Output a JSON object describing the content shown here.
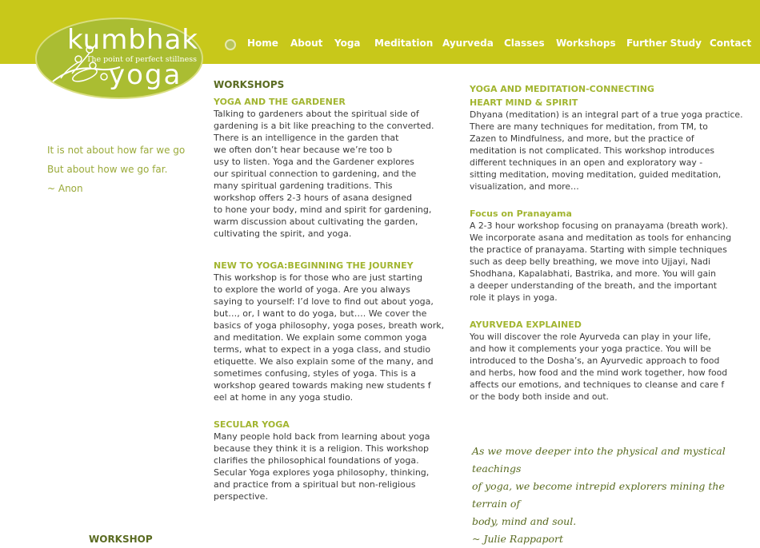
{
  "logo": {
    "top_text": "kumbhak",
    "tagline": "The point of perfect stillness",
    "bottom_text": "yoga"
  },
  "nav": {
    "items": [
      "Home",
      "About",
      "Yoga",
      "Meditation",
      "Ayurveda",
      "Classes",
      "Workshops",
      "Further Study",
      "Contact"
    ]
  },
  "quote_left": {
    "line1": "It is not about how far we go",
    "line2": "But about how we go far.",
    "author": "~ Anon"
  },
  "main": {
    "heading": "WORKSHOPS",
    "sections": [
      {
        "title": "YOGA AND THE GARDENER",
        "lines": [
          "Talking to gardeners about the spiritual side of",
          "gardening is a bit like preaching to the converted.",
          "There is an intelligence in the garden that",
          "we often don’t hear because we’re too b",
          "usy to listen. Yoga and the Gardener explores",
          "our spiritual connection to gardening, and the",
          "many spiritual gardening traditions. This",
          "workshop offers 2-3 hours of asana designed",
          "to hone your body, mind and spirit for gardening,",
          "warm discussion about cultivating the garden,",
          "cultivating the spirit, and yoga."
        ]
      },
      {
        "title": "NEW TO YOGA:BEGINNING THE JOURNEY",
        "lines": [
          "This workshop is for those who are just starting",
          "to explore the world of yoga. Are you always",
          "saying to yourself: I’d love to find out about yoga,",
          "but…, or, I want to do yoga, but…. We cover the",
          "basics of yoga philosophy, yoga poses, breath work,",
          "and meditation. We explain some common yoga",
          "terms, what to expect in a yoga class, and studio",
          "etiquette. We also explain some of the many, and",
          "sometimes confusing, styles of yoga. This is a",
          "workshop geared towards making new students f",
          "eel at home in any yoga studio."
        ]
      },
      {
        "title": "SECULAR YOGA",
        "lines": [
          "Many people hold back from learning about yoga",
          "because they think it is a religion. This workshop",
          "clarifies the philosophical foundations of yoga.",
          "Secular Yoga explores yoga philosophy, thinking,",
          "and practice from a spiritual but non-religious",
          "perspective."
        ]
      }
    ]
  },
  "right": {
    "sections": [
      {
        "title_lines": [
          "YOGA AND MEDITATION-CONNECTING",
          "HEART MIND & SPIRIT"
        ],
        "lines": [
          "Dhyana (meditation) is an integral part of a true yoga practice.",
          " There are many techniques for meditation, from TM, to",
          "Zazen to Mindfulness, and more, but the practice of",
          "meditation is not complicated. This workshop introduces",
          "different techniques in an open and exploratory way -",
          "sitting meditation, moving meditation, guided meditation,",
          "visualization, and more…"
        ]
      },
      {
        "title_lines": [
          "Focus on Pranayama"
        ],
        "lines": [
          "A 2-3 hour workshop focusing on pranayama (breath work).",
          "We incorporate asana and meditation as tools for enhancing",
          "the practice of pranayama. Starting with simple techniques",
          "such as deep belly breathing, we move into Ujjayi, Nadi",
          "Shodhana, Kapalabhati, Bastrika, and more. You will gain",
          "a deeper understanding of the breath, and the important",
          "role it plays in yoga."
        ]
      },
      {
        "title_lines": [
          "AYURVEDA EXPLAINED"
        ],
        "lines": [
          "You will discover the role Ayurveda can play in your life,",
          "and how it complements your yoga practice. You will be",
          "introduced to the Dosha’s, an Ayurvedic approach to food",
          "and herbs, how food and the mind work together, how food",
          "affects our emotions, and techniques to cleanse and care f",
          "or the body both inside and out."
        ]
      }
    ]
  },
  "quote_right": {
    "line1": "As we move deeper into the physical and mystical teachings",
    "line2": "of yoga, we become intrepid explorers mining the terrain of",
    "line3": "body, mind and soul.",
    "author": "~ Julie Rappaport"
  },
  "footer": {
    "title": "WORKSHOP"
  },
  "colors": {
    "topbar": "#c8c81a",
    "logo": "#aabd32",
    "heading": "#5a6b21",
    "section_title": "#a2b530",
    "quote_left": "#9aaa3a"
  }
}
